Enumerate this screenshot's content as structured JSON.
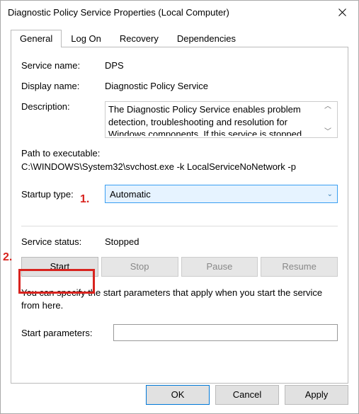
{
  "window": {
    "title": "Diagnostic Policy Service Properties (Local Computer)"
  },
  "tabs": [
    "General",
    "Log On",
    "Recovery",
    "Dependencies"
  ],
  "fields": {
    "service_name_label": "Service name:",
    "service_name": "DPS",
    "display_name_label": "Display name:",
    "display_name": "Diagnostic Policy Service",
    "description_label": "Description:",
    "description": "The Diagnostic Policy Service enables problem detection, troubleshooting and resolution for Windows components.  If this service is stopped",
    "path_label": "Path to executable:",
    "path": "C:\\WINDOWS\\System32\\svchost.exe -k LocalServiceNoNetwork -p",
    "startup_label": "Startup type:",
    "startup_value": "Automatic",
    "status_label": "Service status:",
    "status_value": "Stopped",
    "hint": "You can specify the start parameters that apply when you start the service from here.",
    "params_label": "Start parameters:",
    "params_value": ""
  },
  "buttons": {
    "start": "Start",
    "stop": "Stop",
    "pause": "Pause",
    "resume": "Resume",
    "ok": "OK",
    "cancel": "Cancel",
    "apply": "Apply"
  },
  "callouts": {
    "one": "1.",
    "two": "2."
  }
}
